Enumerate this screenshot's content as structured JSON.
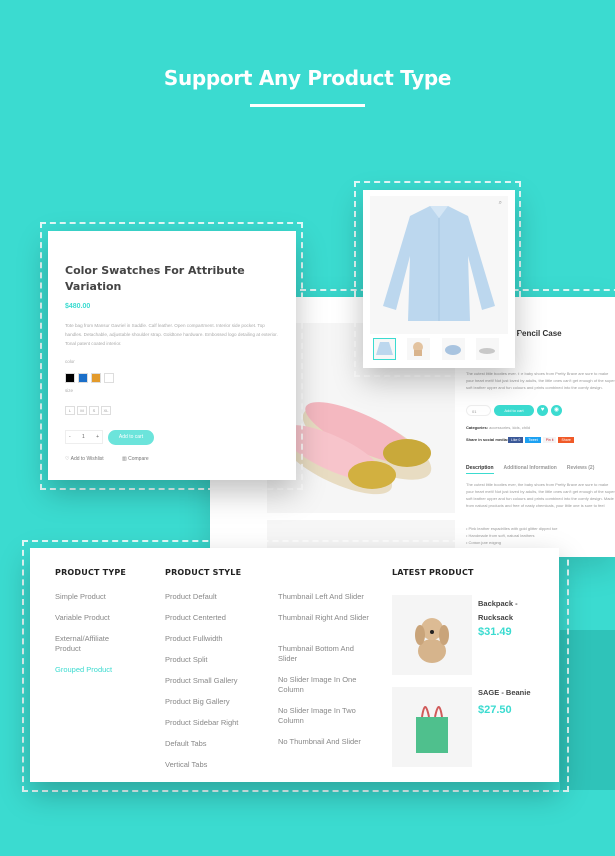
{
  "header": {
    "title": "Support Any Product Type"
  },
  "colors": {
    "background": "#3bdbd0",
    "accent": "#3bdbd0"
  },
  "swatch_card": {
    "title": "Color Swatches For Attribute Variation",
    "price": "$480.00",
    "description": "Tote bag from Mansur Gavriel in Saddle. Calf leather. Open compartment. Interior side pocket. Top handles. Detachable, adjustable shoulder strap. Goldtone hardware. Embossed logo detailing at exterior. Tonal patent coated interior.",
    "color_label": "color",
    "colors": [
      "#000000",
      "#1b6fc9",
      "#e39a2b",
      "#ffffff"
    ],
    "size_label": "size",
    "sizes": [
      "L",
      "M",
      "S",
      "XL"
    ],
    "qty_minus": "-",
    "qty": "1",
    "qty_plus": "+",
    "add_to_cart": "Add to cart",
    "wishlist": "Add to Wishlist",
    "compare": "Compare"
  },
  "product_page": {
    "title": "s Pencil Case",
    "intro": "The cutest little booties ever, the baby shoes from Pretty Brave are sure to make your heart melt! Not just loved by adults, the little ones can't get enough of the super soft leather upper and fun colours and prints combined into the comfy design.",
    "qty": "01",
    "add_to_cart": "Add to cart",
    "categories_label": "Categories:",
    "categories": "accessories, kids, child",
    "share_label": "Share in social media:",
    "share_buttons": [
      "Like 0",
      "Tweet",
      "Pin it",
      "Share"
    ],
    "tabs": [
      "Description",
      "Additional Information",
      "Reviews (2)"
    ],
    "description": "The cutest little booties ever, the baby shoes from Pretty Brave are sure to make your heart melt! Not just loved by adults, the little ones can't get enough of the super soft leather upper and fun colours and prints combined into the comfy design. Made from natural products and free of nasty chemicals, your little one is sure to feel Pretty Brave in these pretty cool shoes.",
    "bullets": [
      "Pink leather espadrilles with gold glitter dipped toe",
      "Handmade from soft, natural leathers",
      "Cotton jute edging"
    ]
  },
  "menu": {
    "product_type": {
      "heading": "PRODUCT TYPE",
      "items": [
        "Simple Product",
        "Variable Product",
        "External/Affiliate Product",
        "Grouped Product"
      ],
      "active": "Grouped Product"
    },
    "product_style": {
      "heading": "PRODUCT STYLE",
      "col1": [
        "Product Default",
        "Product Centerted",
        "Product Fullwidth",
        "Product Split",
        "Product Small Gallery",
        "Product Big Gallery",
        "Product Sidebar Right",
        "Default Tabs",
        "Vertical Tabs"
      ],
      "col2": [
        "Thumbnail Left And Slider",
        "Thumbnail Right And Slider",
        "Thumbnail Bottom And Slider",
        "No Slider Image In One Column",
        "No Slider Image In Two Column",
        "No Thumbnail And Slider"
      ]
    },
    "latest": {
      "heading": "LATEST PRODUCT",
      "products": [
        {
          "name": "Backpack - Rucksack",
          "price": "$31.49"
        },
        {
          "name": "SAGE - Beanie",
          "price": "$27.50"
        }
      ]
    }
  }
}
